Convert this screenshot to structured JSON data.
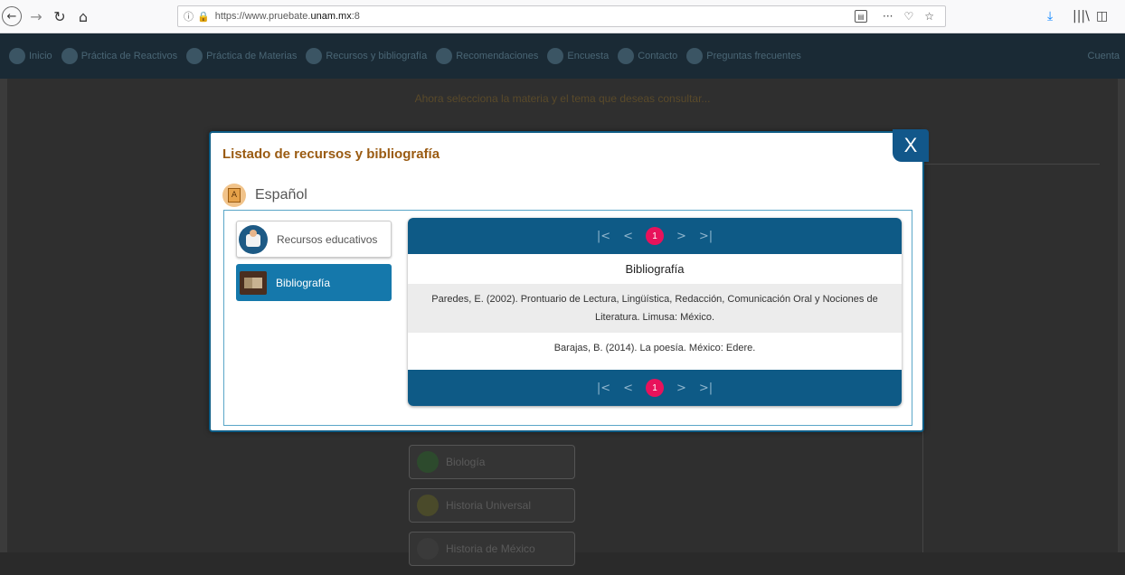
{
  "browser": {
    "url_prefix": "https://www.pruebate.",
    "url_domain": "unam.mx",
    "url_suffix": ":8",
    "icons": [
      "back-icon",
      "forward-icon",
      "reload-icon",
      "home-icon",
      "info-icon",
      "lock-icon",
      "reader-icon",
      "more-icon",
      "pocket-icon",
      "bookmark-star-icon",
      "download-icon",
      "library-icon",
      "sidebar-icon"
    ]
  },
  "site": {
    "nav_items": [
      "Inicio",
      "Práctica de Reactivos",
      "Práctica de Materias",
      "Recursos y bibliografía",
      "Recomendaciones",
      "Encuesta",
      "Contacto",
      "Preguntas frecuentes"
    ],
    "nav_right": "Cuenta",
    "subtitle": "Ahora selecciona la materia y el tema que deseas consultar...",
    "subjects": [
      "Biología",
      "Historia Universal",
      "Historia de México"
    ]
  },
  "modal": {
    "title": "Listado de recursos y bibliografía",
    "close_label": "X",
    "subject": "Español",
    "tabs": [
      "Recursos educativos",
      "Bibliografía"
    ],
    "pager": {
      "first": "|<",
      "prev": "<",
      "page": "1",
      "next": ">",
      "last": ">|"
    },
    "table_header": "Bibliografía",
    "rows": [
      "Paredes, E. (2002). Prontuario de Lectura, Lingüística, Redacción, Comunicación Oral y Nociones de Literatura. Limusa: México.",
      "Barajas, B. (2014). La poesía. México: Edere."
    ]
  },
  "colors": {
    "accent": "#0e5a86",
    "title": "#9a5b12",
    "active_tab": "#1578ab",
    "page_badge": "#e8125b"
  }
}
